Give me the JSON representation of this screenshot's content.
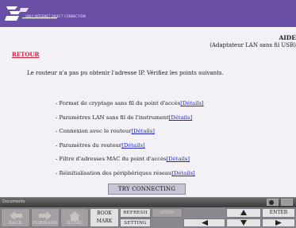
{
  "brand": {
    "sub_text": "ONLY INTERNET DIRECT CONNECTION"
  },
  "header": {
    "aide": "AIDE",
    "subtitle": "(Adaptateur LAN sans fil USB)"
  },
  "retour_label": "RETOUR",
  "message": "Le routeur n'a pas pu obtenir l'adresse IP. Vérifiez les points suivants.",
  "checklist": [
    {
      "text": "- Format de cryptage sans fil du point d'accès",
      "link": "[Détails]"
    },
    {
      "text": "- Paramètres LAN sans fil de l'instrument",
      "link": "[Détails]"
    },
    {
      "text": "- Connexion avec le routeur",
      "link": "[Détails]"
    },
    {
      "text": "- Paramètres du routeur",
      "link": "[Détails]"
    },
    {
      "text": "- Filtre d'adresses MAC du point d'accès",
      "link": "[Détails]"
    },
    {
      "text": "- Réinitialisation des périphériques réseau",
      "link": "[Détails]"
    }
  ],
  "try_button": "TRY CONNECTING",
  "status": {
    "text": "Documents"
  },
  "toolbar": {
    "back": "BACK",
    "forward": "FORWARD",
    "home": "HOME",
    "bookmark_line1": "BOOK",
    "bookmark_line2": "MARK",
    "refresh": "REFRESH",
    "stop": "STOP",
    "setting": "SETTING",
    "enter": "ENTER"
  },
  "colors": {
    "brand_bar": "#6a4fa6",
    "link_red": "#cc1f3b",
    "link_blue": "#2027c9"
  }
}
